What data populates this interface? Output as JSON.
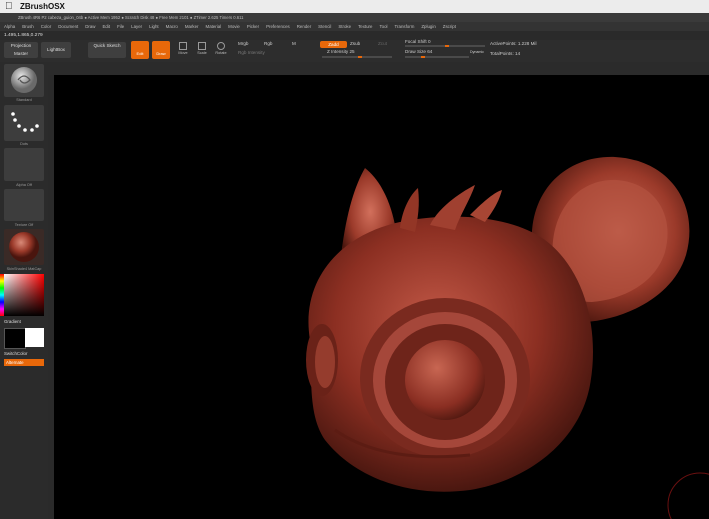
{
  "menubar": {
    "apple": "",
    "app_name": "ZBrushOSX"
  },
  "titlebar": {
    "text": "ZBrush 4R6 P2     cabeza_guion_04b     ● Active Mem 1952 ● Scratch Disk 48 ● Free Mem 2101 ● ZTimer 2.625 Timers 0.611"
  },
  "zmenus": [
    "Alpha",
    "Brush",
    "Color",
    "Document",
    "Draw",
    "Edit",
    "File",
    "Layer",
    "Light",
    "Macro",
    "Marker",
    "Material",
    "Movie",
    "Picker",
    "Preferences",
    "Render",
    "Stencil",
    "Stroke",
    "Texture",
    "Tool",
    "Transform",
    "Zplugin",
    "Zscript"
  ],
  "coords": "1.495,1.865,0.279",
  "shelf": {
    "projection_master": "Projection Master",
    "lightbox": "LightBox",
    "quick_sketch": "Quick Sketch",
    "edit": "Edit",
    "draw": "Draw",
    "move": "Move",
    "scale": "Scale",
    "rotate": "Rotate",
    "mrgb": "Mrgb",
    "rgb": "Rgb",
    "m": "M",
    "rgb_intensity": "Rgb Intensity",
    "zadd": "Zadd",
    "zsub": "Zsub",
    "zcut": "Zcut",
    "z_intensity_label": "Z Intensity",
    "z_intensity_value": "25",
    "focal_shift_label": "Focal Shift",
    "focal_shift_value": "0",
    "draw_size_label": "Draw Size",
    "draw_size_value": "64",
    "dynamic": "Dynamic",
    "active_points": "ActivePoints: 1.228 Mil",
    "total_points": "TotalPoints: 14"
  },
  "left_shelf": {
    "brush_label": "Standard",
    "stroke_label": "Dots",
    "alpha_label": "Alpha Off",
    "texture_label": "Texture Off",
    "material_label": "SkinShade4 MatCap",
    "gradient": "Gradient",
    "switch_color": "SwitchColor",
    "alternate": "Alternate"
  },
  "colors": {
    "accent": "#e8680a",
    "model": "#8c2f22",
    "viewport_bg": "#000000"
  }
}
